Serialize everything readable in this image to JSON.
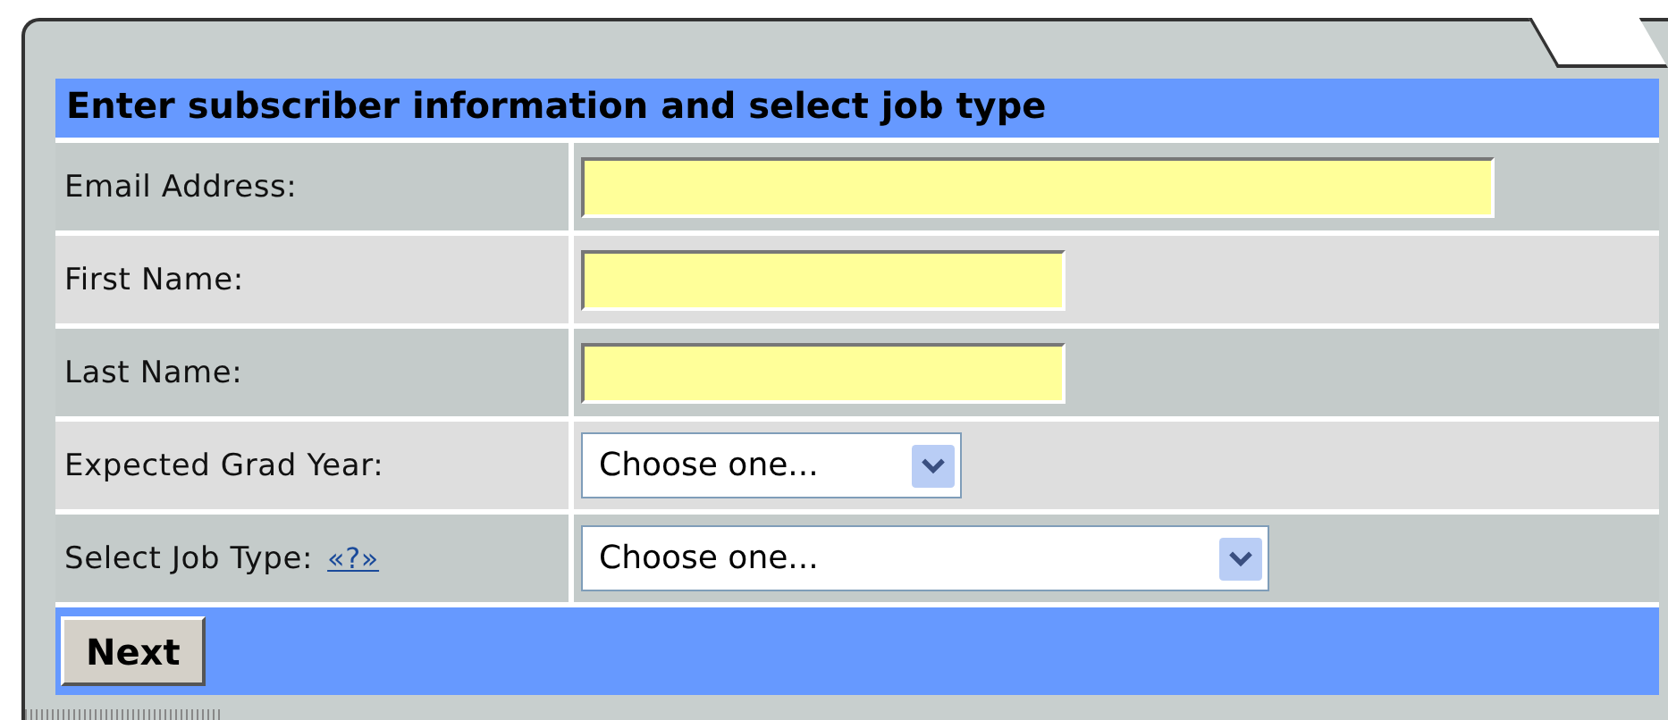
{
  "form": {
    "title": "Enter subscriber information and select job type",
    "fields": [
      {
        "kind": "text",
        "label": "Email Address:"
      },
      {
        "kind": "text",
        "label": "First Name:"
      },
      {
        "kind": "text",
        "label": "Last Name:"
      },
      {
        "kind": "select",
        "label": "Expected Grad Year:",
        "value": "Choose one..."
      },
      {
        "kind": "select",
        "label": "Select Job Type:",
        "help_link": "«?»",
        "value": "Choose one..."
      }
    ],
    "button": "Next"
  }
}
